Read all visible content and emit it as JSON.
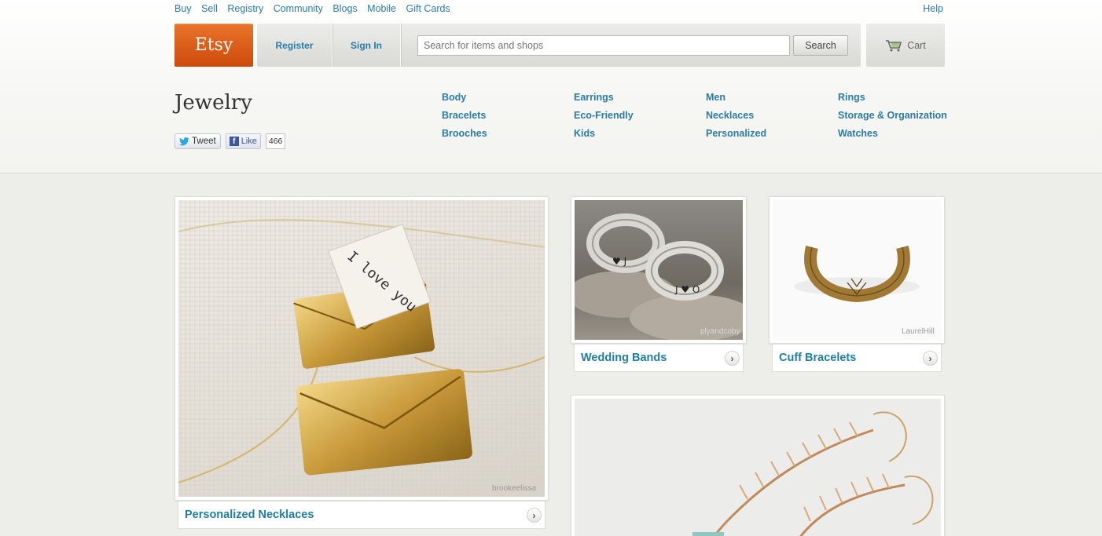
{
  "top_links": [
    "Buy",
    "Sell",
    "Registry",
    "Community",
    "Blogs",
    "Mobile",
    "Gift Cards"
  ],
  "help": "Help",
  "logo": "Etsy",
  "nav": {
    "register": "Register",
    "sign_in": "Sign In"
  },
  "search": {
    "placeholder": "Search for items and shops",
    "button": "Search"
  },
  "cart": {
    "label": "Cart",
    "icon": "cart-icon"
  },
  "category": {
    "title": "Jewelry",
    "tweet": "Tweet",
    "like": "Like",
    "like_count": "466"
  },
  "subcategories": [
    "Body",
    "Bracelets",
    "Brooches",
    "Earrings",
    "Eco-Friendly",
    "Kids",
    "Men",
    "Necklaces",
    "Personalized",
    "Rings",
    "Storage & Organization",
    "Watches"
  ],
  "features": {
    "necklaces": {
      "label": "Personalized Necklaces",
      "credit": "brookeelissa",
      "photo_text": "I love you"
    },
    "wedding": {
      "label": "Wedding Bands",
      "credit": "plyandcoby"
    },
    "cuff": {
      "label": "Cuff Bracelets",
      "credit": "LaurelHill"
    }
  },
  "colors": {
    "link": "#2a7ba6",
    "brand_orange": "#d9581a",
    "background": "#ededea"
  }
}
